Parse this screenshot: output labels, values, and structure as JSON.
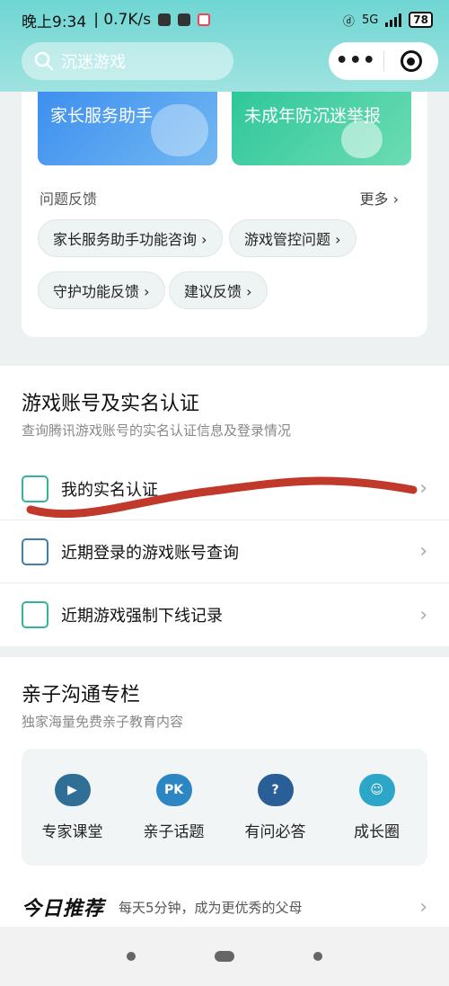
{
  "status_bar": {
    "time": "晚上9:34",
    "speed": "| 0.7K/s",
    "network": "5G",
    "battery": "78"
  },
  "search": {
    "placeholder": "沉迷游戏"
  },
  "tiles": [
    {
      "label": "家长服务助手"
    },
    {
      "label": "未成年防沉迷举报"
    }
  ],
  "feedback": {
    "title": "问题反馈",
    "more": "更多 ›",
    "chips": [
      "家长服务助手功能咨询 ›",
      "游戏管控问题 ›",
      "守护功能反馈 ›",
      "建议反馈 ›"
    ]
  },
  "account_section": {
    "title": "游戏账号及实名认证",
    "subtitle": "查询腾讯游戏账号的实名认证信息及登录情况",
    "rows": [
      {
        "label": "我的实名认证",
        "icon": "id-card-check-icon"
      },
      {
        "label": "近期登录的游戏账号查询",
        "icon": "document-search-icon"
      },
      {
        "label": "近期游戏强制下线记录",
        "icon": "hourglass-icon"
      }
    ]
  },
  "parent_section": {
    "title": "亲子沟通专栏",
    "subtitle": "独家海量免费亲子教育内容",
    "items": [
      {
        "label": "专家课堂",
        "icon": "graduation-cap-icon",
        "glyph": "▶"
      },
      {
        "label": "亲子话题",
        "icon": "pk-bubble-icon",
        "glyph": "PK"
      },
      {
        "label": "有问必答",
        "icon": "question-bubble-icon",
        "glyph": "?"
      },
      {
        "label": "成长圈",
        "icon": "smile-person-icon",
        "glyph": "☺"
      }
    ],
    "today": {
      "badge": "今日推荐",
      "text": "每天5分钟，成为更优秀的父母"
    }
  },
  "chevron": "›",
  "colors": {
    "header": "#6fd6d3",
    "tile_blue": "#3d8ff0",
    "tile_green": "#2fc79a",
    "scribble": "#c0392b"
  }
}
